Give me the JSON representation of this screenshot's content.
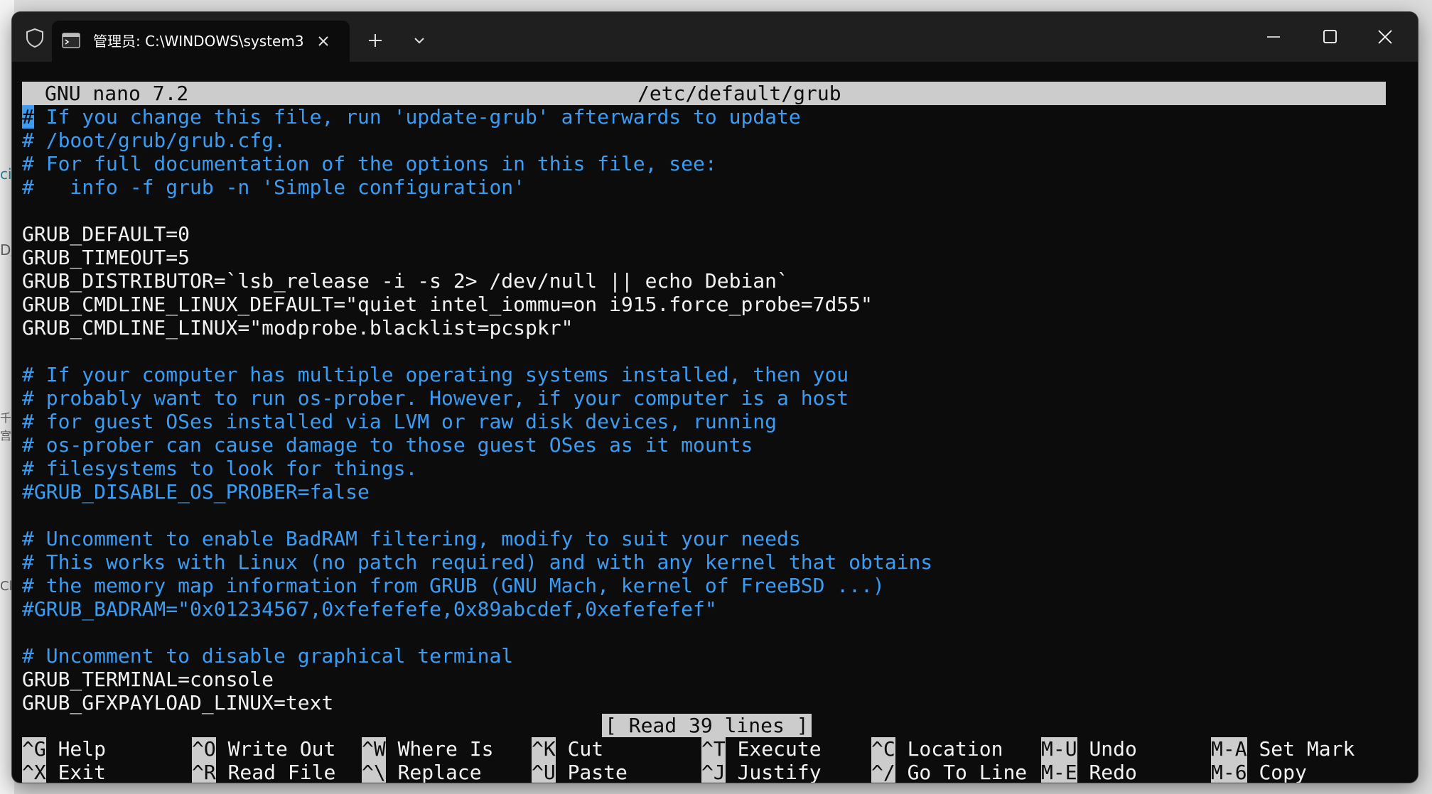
{
  "window": {
    "tab_title": "管理员: C:\\WINDOWS\\system3",
    "new_tab_label": "+",
    "minimize_icon": "minimize-icon",
    "maximize_icon": "maximize-icon",
    "close_icon": "close-icon"
  },
  "background": {
    "fragments": [
      "ci",
      "D/",
      "千",
      "宫",
      "Cl"
    ]
  },
  "nano": {
    "version": "GNU nano 7.2",
    "filename": "/etc/default/grub",
    "status": "[ Read 39 lines ]",
    "lines": [
      {
        "text": "# If you change this file, run 'update-grub' afterwards to update",
        "kind": "comment"
      },
      {
        "text": "# /boot/grub/grub.cfg.",
        "kind": "comment"
      },
      {
        "text": "# For full documentation of the options in this file, see:",
        "kind": "comment"
      },
      {
        "text": "#   info -f grub -n 'Simple configuration'",
        "kind": "comment"
      },
      {
        "text": "",
        "kind": "blank"
      },
      {
        "text": "GRUB_DEFAULT=0",
        "kind": "text"
      },
      {
        "text": "GRUB_TIMEOUT=5",
        "kind": "text"
      },
      {
        "text": "GRUB_DISTRIBUTOR=`lsb_release -i -s 2> /dev/null || echo Debian`",
        "kind": "text"
      },
      {
        "text": "GRUB_CMDLINE_LINUX_DEFAULT=\"quiet intel_iommu=on i915.force_probe=7d55\"",
        "kind": "text"
      },
      {
        "text": "GRUB_CMDLINE_LINUX=\"modprobe.blacklist=pcspkr\"",
        "kind": "text"
      },
      {
        "text": "",
        "kind": "blank"
      },
      {
        "text": "# If your computer has multiple operating systems installed, then you",
        "kind": "comment"
      },
      {
        "text": "# probably want to run os-prober. However, if your computer is a host",
        "kind": "comment"
      },
      {
        "text": "# for guest OSes installed via LVM or raw disk devices, running",
        "kind": "comment"
      },
      {
        "text": "# os-prober can cause damage to those guest OSes as it mounts",
        "kind": "comment"
      },
      {
        "text": "# filesystems to look for things.",
        "kind": "comment"
      },
      {
        "text": "#GRUB_DISABLE_OS_PROBER=false",
        "kind": "comment"
      },
      {
        "text": "",
        "kind": "blank"
      },
      {
        "text": "# Uncomment to enable BadRAM filtering, modify to suit your needs",
        "kind": "comment"
      },
      {
        "text": "# This works with Linux (no patch required) and with any kernel that obtains",
        "kind": "comment"
      },
      {
        "text": "# the memory map information from GRUB (GNU Mach, kernel of FreeBSD ...)",
        "kind": "comment"
      },
      {
        "text": "#GRUB_BADRAM=\"0x01234567,0xfefefefe,0x89abcdef,0xefefefef\"",
        "kind": "comment"
      },
      {
        "text": "",
        "kind": "blank"
      },
      {
        "text": "# Uncomment to disable graphical terminal",
        "kind": "comment"
      },
      {
        "text": "GRUB_TERMINAL=console",
        "kind": "text"
      },
      {
        "text": "GRUB_GFXPAYLOAD_LINUX=text",
        "kind": "text"
      }
    ],
    "shortcuts": [
      {
        "key": "^G",
        "label": "Help"
      },
      {
        "key": "^O",
        "label": "Write Out"
      },
      {
        "key": "^W",
        "label": "Where Is"
      },
      {
        "key": "^K",
        "label": "Cut"
      },
      {
        "key": "^T",
        "label": "Execute"
      },
      {
        "key": "^C",
        "label": "Location"
      },
      {
        "key": "M-U",
        "label": "Undo"
      },
      {
        "key": "M-A",
        "label": "Set Mark"
      },
      {
        "key": "^X",
        "label": "Exit"
      },
      {
        "key": "^R",
        "label": "Read File"
      },
      {
        "key": "^\\",
        "label": "Replace"
      },
      {
        "key": "^U",
        "label": "Paste"
      },
      {
        "key": "^J",
        "label": "Justify"
      },
      {
        "key": "^/",
        "label": "Go To Line"
      },
      {
        "key": "M-E",
        "label": "Redo"
      },
      {
        "key": "M-6",
        "label": "Copy"
      }
    ]
  }
}
